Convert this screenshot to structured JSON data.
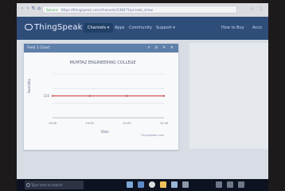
{
  "browser": {
    "url": "https://thingspeak.com/channels/338471/private_show",
    "secure_label": "Secure"
  },
  "app": {
    "logo_text": "ThingSpeak",
    "nav": [
      "Channels ▾",
      "Apps",
      "Community",
      "Support ▾",
      "How to Buy",
      "Acco"
    ]
  },
  "panel": {
    "title": "Field 1 Chart",
    "tools": "↗ ⊙ ✎ ✕"
  },
  "chart_data": {
    "type": "line",
    "title": "MUMTAZ ENGINEERING COLLEGE",
    "xlabel": "Date",
    "ylabel": "Humidity",
    "ytick_labels": [
      "150"
    ],
    "xtick_labels": [
      "14:00",
      "14:30",
      "15:00",
      "15:30"
    ],
    "credit": "ThingSpeak.com",
    "x": [
      "14:00",
      "14:30",
      "15:00",
      "15:30"
    ],
    "series": [
      {
        "values": [
          150,
          150,
          150,
          150
        ]
      }
    ],
    "ylim": [
      0,
      300
    ],
    "colors": {
      "line": "#d9534f",
      "marker": "#b74b4b",
      "grid": "#d7dce3"
    }
  },
  "taskbar": {
    "search_placeholder": "Type here to search"
  },
  "icons": [
    "back-icon",
    "forward-icon",
    "refresh-icon",
    "home-icon",
    "lock-icon",
    "star-icon",
    "menu-icon"
  ]
}
